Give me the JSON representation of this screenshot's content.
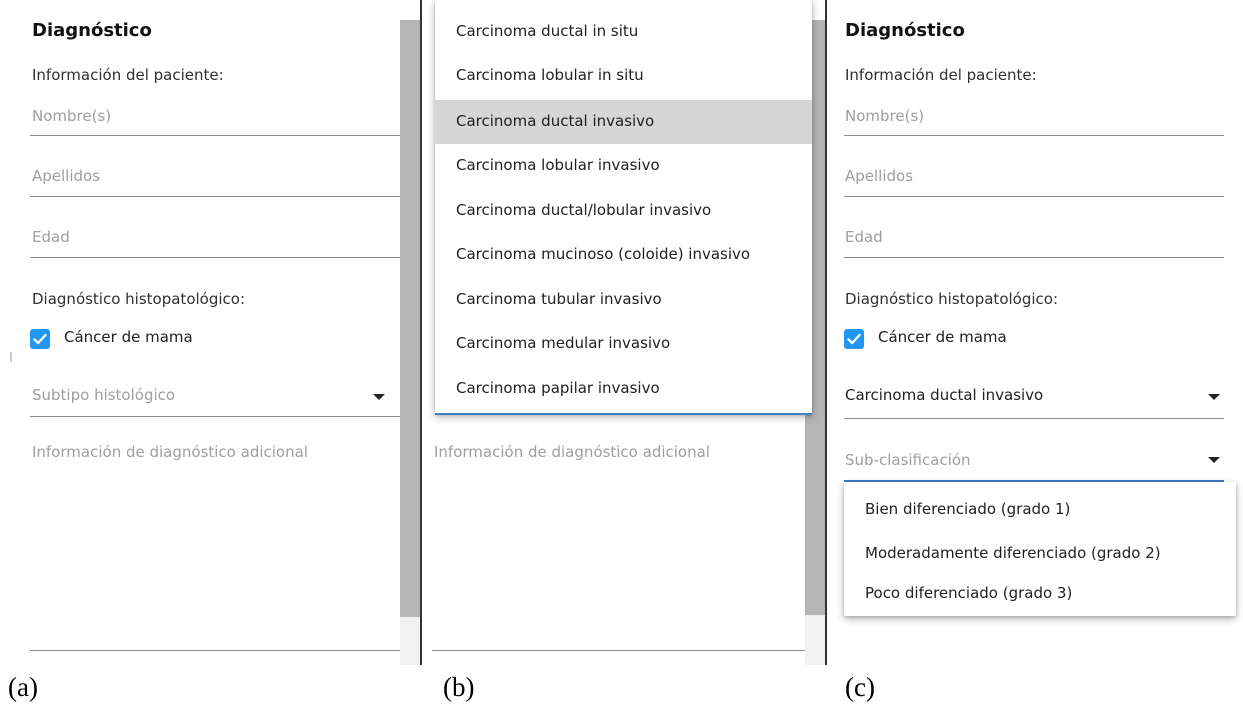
{
  "form": {
    "title": "Diagnóstico",
    "patient_section": "Información del paciente:",
    "first_name_placeholder": "Nombre(s)",
    "last_name_placeholder": "Apellidos",
    "age_placeholder": "Edad",
    "histo_section": "Diagnóstico histopatológico:",
    "breast_cancer_label": "Cáncer de mama",
    "breast_cancer_checked": true,
    "subtype_placeholder": "Subtipo histológico",
    "additional_info_placeholder": "Información de diagnóstico adicional",
    "subclass_placeholder": "Sub-clasificación"
  },
  "panel_b": {
    "subtype_options": [
      "Carcinoma ductal in situ",
      "Carcinoma lobular in situ",
      "Carcinoma ductal invasivo",
      "Carcinoma lobular invasivo",
      "Carcinoma ductal/lobular invasivo",
      "Carcinoma mucinoso (coloide) invasivo",
      "Carcinoma tubular invasivo",
      "Carcinoma medular invasivo",
      "Carcinoma papilar invasivo"
    ],
    "highlighted_option": "Carcinoma ductal invasivo"
  },
  "panel_c": {
    "selected_subtype": "Carcinoma ductal invasivo",
    "subclass_options": [
      "Bien diferenciado (grado 1)",
      "Moderadamente diferenciado (grado 2)",
      "Poco diferenciado (grado 3)"
    ]
  },
  "captions": {
    "a": "(a)",
    "b": "(b)",
    "c": "(c)"
  },
  "colors": {
    "checkbox": "#2196f3",
    "highlight": "#d6d6d6",
    "focus_line": "#3f7fc4"
  }
}
